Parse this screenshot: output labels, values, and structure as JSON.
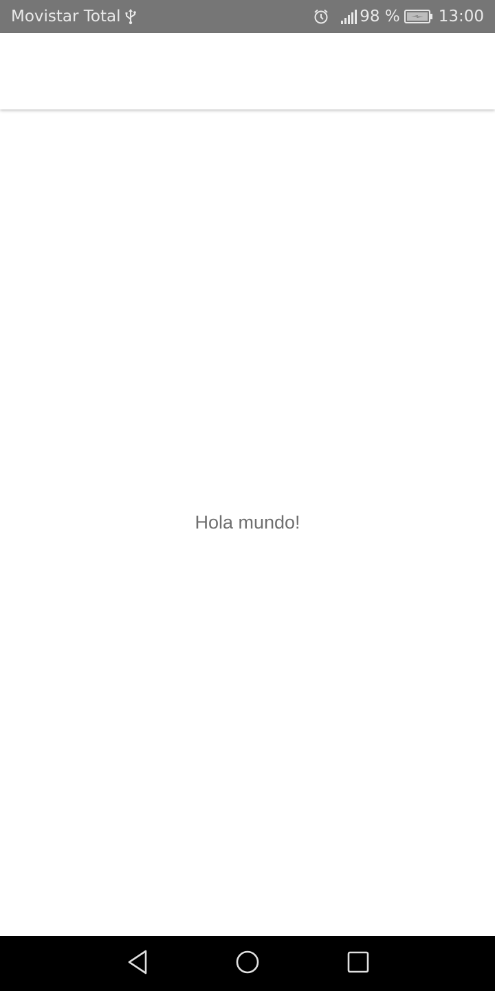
{
  "status_bar": {
    "carrier": "Movistar Total",
    "battery_percent": "98 %",
    "time": "13:00",
    "icons": [
      "usb-icon",
      "alarm-icon",
      "signal-icon",
      "battery-charging-icon"
    ]
  },
  "app_bar": {
    "title": ""
  },
  "content": {
    "message": "Hola mundo!"
  },
  "nav_bar": {
    "icons": [
      "back-icon",
      "home-icon",
      "recents-icon"
    ]
  },
  "colors": {
    "status_bar_bg": "#767676",
    "status_text": "#e9e9e9",
    "message_text": "#6f6f6f",
    "nav_bar_bg": "#000000"
  }
}
